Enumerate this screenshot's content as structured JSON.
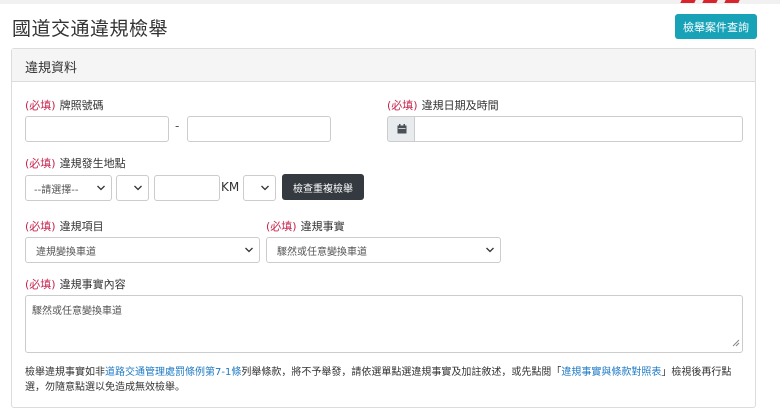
{
  "header": {
    "title": "國道交通違規檢舉",
    "query_button": "檢舉案件查詢",
    "brand_color": "#d9232d",
    "accent": "#17a2b8"
  },
  "panel": {
    "heading": "違規資料"
  },
  "form": {
    "required_tag": "(必填)",
    "plate": {
      "label": "牌照號碼",
      "separator": "-",
      "value1": "",
      "value2": ""
    },
    "datetime": {
      "label": "違規日期及時間",
      "icon": "calendar-icon",
      "value": ""
    },
    "location": {
      "label": "違規發生地點",
      "select1": "--請選擇--",
      "select2": "",
      "km_value": "",
      "km_unit": "KM",
      "select3": "",
      "check_button": "檢查重複檢舉"
    },
    "item": {
      "label": "違規項目",
      "selected": "違規變換車道"
    },
    "fact": {
      "label": "違規事實",
      "selected": "驟然或任意變換車道"
    },
    "content": {
      "label": "違規事實內容",
      "value": "驟然或任意變換車道"
    }
  },
  "notice": {
    "part1": "檢舉違規事實如非",
    "link1": "道路交通管理處罰條例第7-1條",
    "part2": "列舉條款，將不予舉發，請依選單點選違規事實及加註敘述，或先點閱「",
    "link2": "違規事實與條款對照表",
    "part3": "」檢視後再行點選，勿隨意點選以免造成無效檢舉。"
  }
}
